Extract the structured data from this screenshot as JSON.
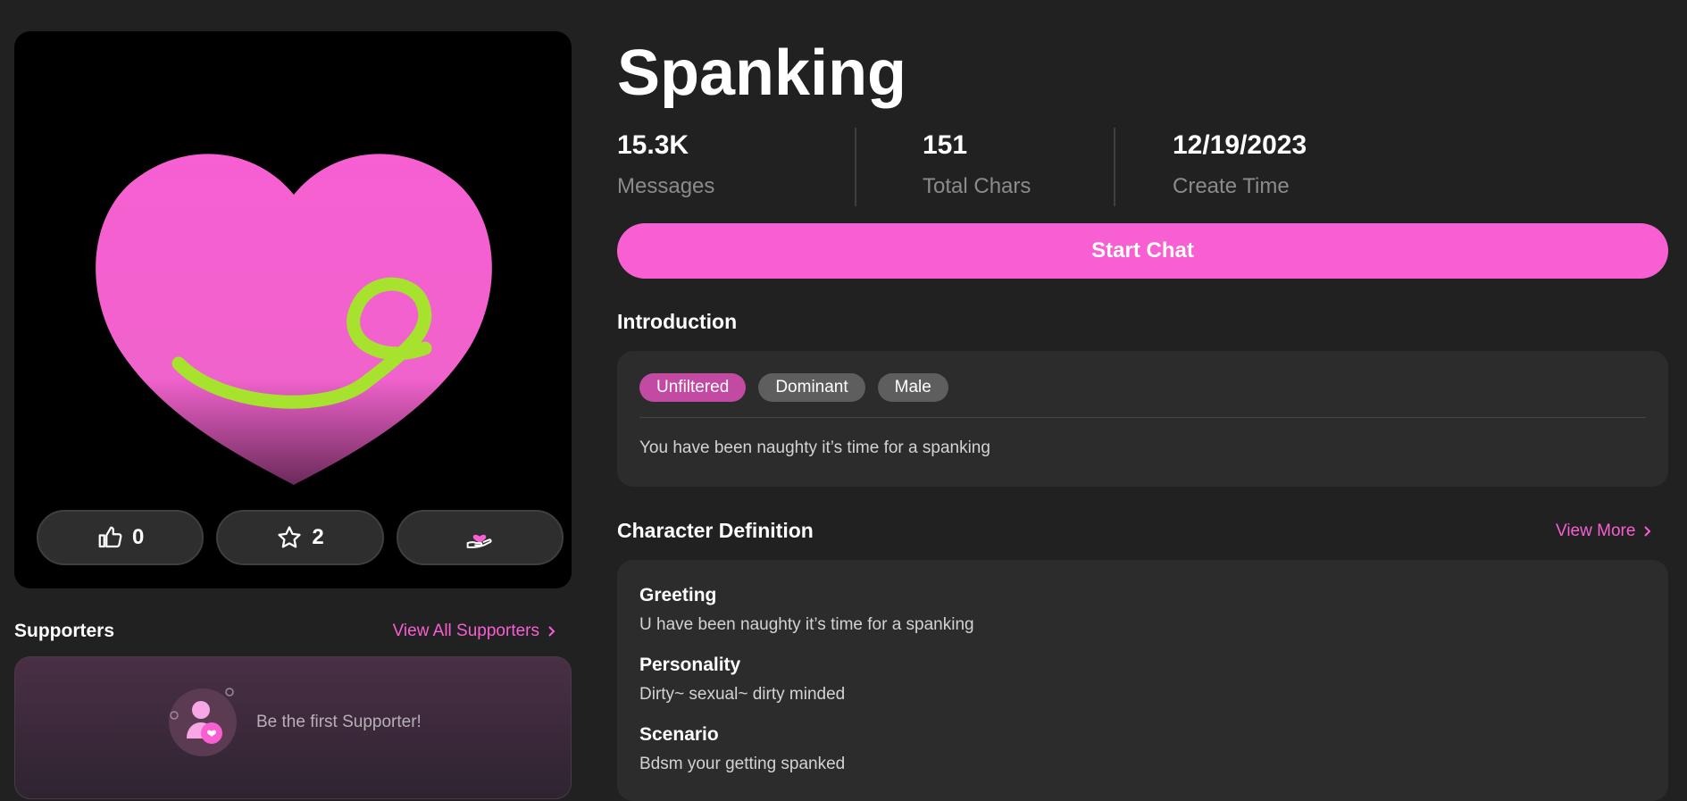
{
  "character": {
    "name": "Spanking",
    "stats": [
      {
        "value": "15.3K",
        "label": "Messages"
      },
      {
        "value": "151",
        "label": "Total Chars"
      },
      {
        "value": "12/19/2023",
        "label": "Create Time"
      }
    ]
  },
  "actions": {
    "likes": "0",
    "favorites": "2"
  },
  "start_chat_label": "Start Chat",
  "supporters": {
    "title": "Supporters",
    "view_all": "View All Supporters",
    "empty_text": "Be the first Supporter!"
  },
  "introduction": {
    "title": "Introduction",
    "tags": [
      "Unfiltered",
      "Dominant",
      "Male"
    ],
    "text": "You have been naughty it’s time for a spanking"
  },
  "definition": {
    "title": "Character Definition",
    "view_more": "View More",
    "items": [
      {
        "label": "Greeting",
        "value": "U have been naughty it’s time for a spanking"
      },
      {
        "label": "Personality",
        "value": "Dirty~ sexual~ dirty minded"
      },
      {
        "label": "Scenario",
        "value": "Bdsm your getting spanked"
      }
    ]
  },
  "colors": {
    "accent": "#f75fd2",
    "background": "#212121",
    "panel": "#2c2c2c",
    "tag_active": "#c24aa3",
    "tag": "#5e5e5e"
  }
}
